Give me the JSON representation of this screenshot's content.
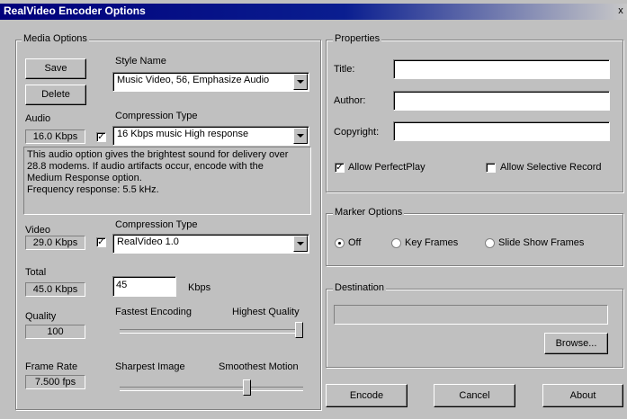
{
  "window": {
    "title": "RealVideo Encoder Options",
    "close_label": "x"
  },
  "media": {
    "group_label": "Media Options",
    "save_label": "Save",
    "delete_label": "Delete",
    "style_name_label": "Style Name",
    "style_name_value": "Music Video, 56, Emphasize Audio",
    "audio_label": "Audio",
    "audio_kbps": "16.0 Kbps",
    "audio_checked": true,
    "audio_compression_label": "Compression Type",
    "audio_compression_value": "16 Kbps music High response",
    "audio_description": "This audio option gives the brightest sound for delivery over\n28.8 modems. If audio artifacts occur, encode with the\nMedium Response option.\nFrequency response: 5.5 kHz.",
    "video_label": "Video",
    "video_kbps": "29.0 Kbps",
    "video_checked": true,
    "video_compression_label": "Compression Type",
    "video_compression_value": "RealVideo 1.0",
    "total_label": "Total",
    "total_kbps": "45.0 Kbps",
    "target_value": "45",
    "target_unit": "Kbps",
    "quality_label": "Quality",
    "quality_value": "100",
    "quality_left_label": "Fastest Encoding",
    "quality_right_label": "Highest Quality",
    "quality_slider_fraction": 1.0,
    "framerate_label": "Frame Rate",
    "framerate_value": "7.500 fps",
    "framerate_left_label": "Sharpest Image",
    "framerate_right_label": "Smoothest Motion",
    "framerate_slider_fraction": 0.7
  },
  "properties": {
    "group_label": "Properties",
    "title_label": "Title:",
    "title_value": "",
    "author_label": "Author:",
    "author_value": "",
    "copyright_label": "Copyright:",
    "copyright_value": "",
    "allow_perfectplay_label": "Allow PerfectPlay",
    "allow_perfectplay_checked": true,
    "allow_selective_record_label": "Allow Selective Record",
    "allow_selective_record_checked": false
  },
  "markers": {
    "group_label": "Marker Options",
    "options": [
      "Off",
      "Key Frames",
      "Slide Show Frames"
    ],
    "selected": "Off"
  },
  "destination": {
    "group_label": "Destination",
    "value": "",
    "browse_label": "Browse..."
  },
  "footer": {
    "encode_label": "Encode",
    "cancel_label": "Cancel",
    "about_label": "About"
  }
}
